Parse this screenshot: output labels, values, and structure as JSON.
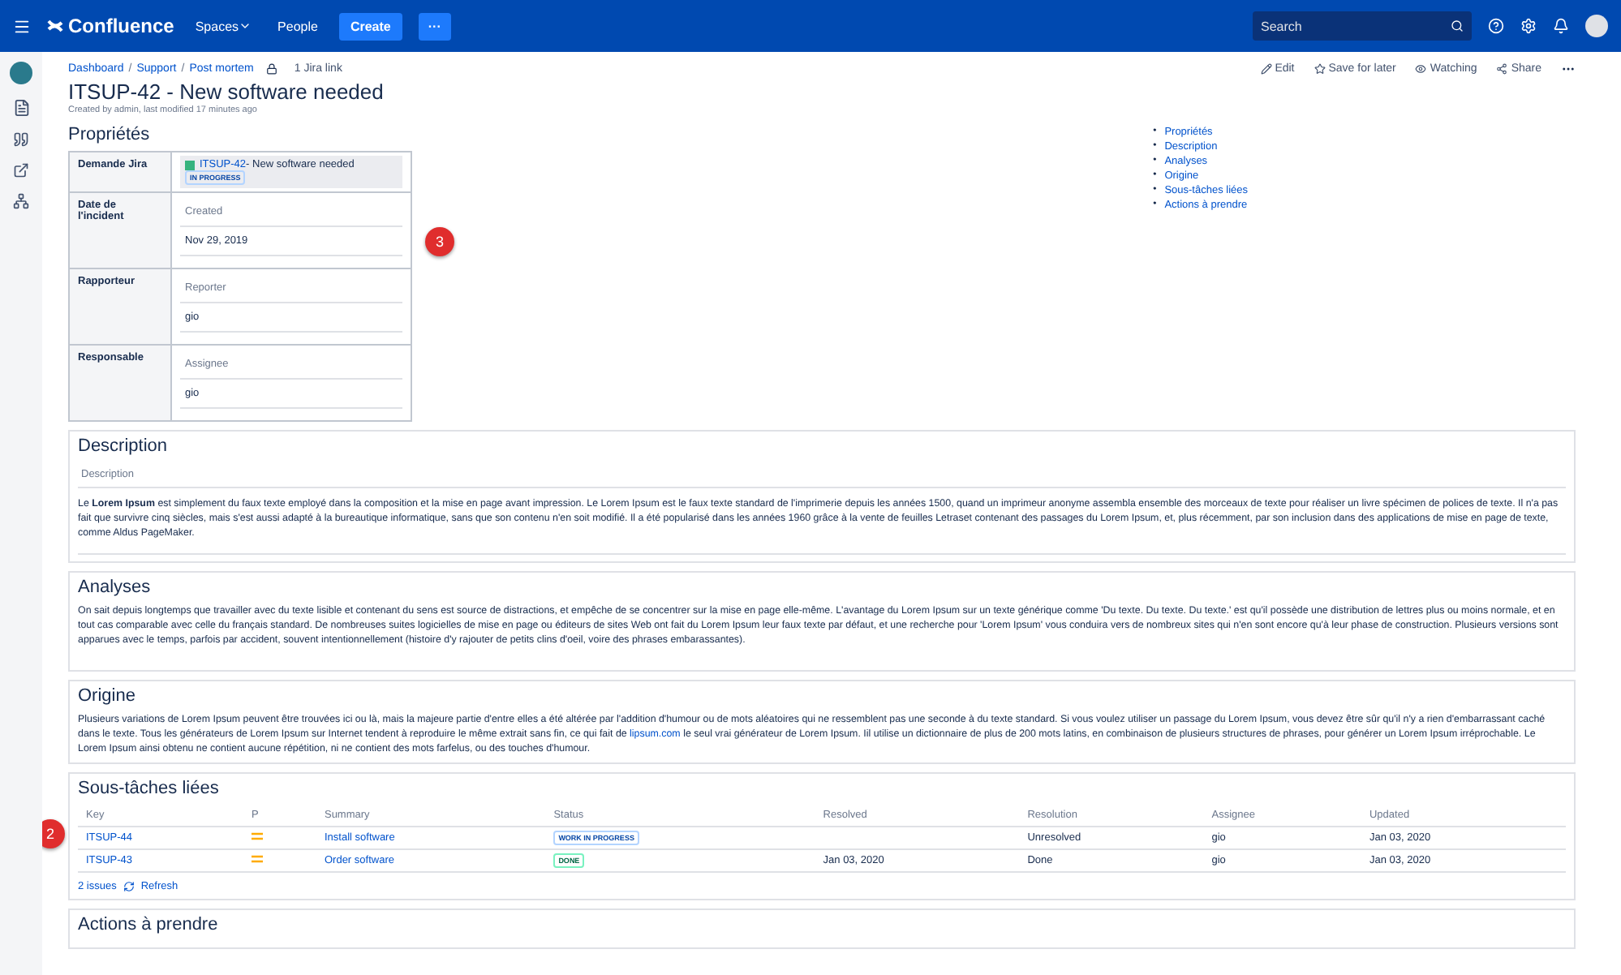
{
  "topbar": {
    "brand": "Confluence",
    "nav": [
      {
        "label": "Spaces",
        "dropdown": true
      },
      {
        "label": "People",
        "dropdown": false
      }
    ],
    "create": "Create",
    "more": "···",
    "search": {
      "placeholder": "Search"
    }
  },
  "breadcrumbs": [
    {
      "kind": "link",
      "text": "Dashboard"
    },
    {
      "kind": "separator",
      "text": "/"
    },
    {
      "kind": "link",
      "text": "Support"
    },
    {
      "kind": "separator",
      "text": "/"
    },
    {
      "kind": "link",
      "text": "Post mortem"
    }
  ],
  "jira_link": "1 Jira link",
  "actions": [
    "Edit",
    "Save for later",
    "Watching",
    "Share"
  ],
  "page": {
    "title": "ITSUP-42 - New software needed",
    "byline": "Created by admin, last modified 17 minutes ago"
  },
  "toc": [
    {
      "bullet": "•",
      "label": "Propriétés"
    },
    {
      "bullet": "•",
      "label": "Description"
    },
    {
      "bullet": "•",
      "label": "Analyses"
    },
    {
      "bullet": "•",
      "label": "Origine"
    },
    {
      "bullet": "•",
      "label": "Sous-tâches liées"
    },
    {
      "bullet": "•",
      "label": "Actions à prendre"
    }
  ],
  "properties": {
    "heading": "Propriétés",
    "jira": {
      "label": "Demande Jira",
      "key": "ITSUP-42",
      "summary": " - New software needed",
      "status": "IN PROGRESS"
    },
    "fields": [
      {
        "label": "Date de l'incident",
        "field": "Created",
        "value": "Nov 29, 2019"
      },
      {
        "label": "Rapporteur",
        "field": "Reporter",
        "value": "gio"
      },
      {
        "label": "Responsable",
        "field": "Assignee",
        "value": "gio"
      }
    ]
  },
  "markers": [
    "3",
    "2"
  ],
  "description": {
    "heading": "Description",
    "field": "Description",
    "text": "Le **Lorem Ipsum** est simplement du faux texte employé dans la composition et la mise en page avant impression. Le Lorem Ipsum est le faux texte standard de l'imprimerie depuis les années 1500, quand un imprimeur anonyme assembla ensemble des morceaux de texte pour réaliser un livre spécimen de polices de texte. Il n'a pas fait que survivre cinq siècles, mais s'est aussi adapté à la bureautique informatique, sans que son contenu n'en soit modifié. Il a été popularisé dans les années 1960 grâce à la vente de feuilles Letraset contenant des passages du Lorem Ipsum, et, plus récemment, par son inclusion dans des applications de mise en page de texte, comme Aldus PageMaker."
  },
  "analyses": {
    "heading": "Analyses",
    "text": "On sait depuis longtemps que travailler avec du texte lisible et contenant du sens est source de distractions, et empêche de se concentrer sur la mise en page elle-même. L'avantage du Lorem Ipsum sur un texte générique comme 'Du texte. Du texte. Du texte.' est qu'il possède une distribution de lettres plus ou moins normale, et en tout cas comparable avec celle du français standard. De nombreuses suites logicielles de mise en page ou éditeurs de sites Web ont fait du Lorem Ipsum leur faux texte par défaut, et une recherche pour 'Lorem Ipsum' vous conduira vers de nombreux sites qui n'en sont encore qu'à leur phase de construction. Plusieurs versions sont apparues avec le temps, parfois par accident, souvent intentionnellement (histoire d'y rajouter de petits clins d'oeil, voire des phrases embarassantes)."
  },
  "origine": {
    "heading": "Origine",
    "text_before": "Plusieurs variations de Lorem Ipsum peuvent être trouvées ici ou là, mais la majeure partie d'entre elles a été altérée par l'addition d'humour ou de mots aléatoires qui ne ressemblent pas une seconde à du texte standard. Si vous voulez utiliser un passage du Lorem Ipsum, vous devez être sûr qu'il n'y a rien d'embarrassant caché dans le texte. Tous les générateurs de Lorem Ipsum sur Internet tendent à reproduire le même extrait sans fin, ce qui fait de ",
    "link": "lipsum.com",
    "text_after": " le seul vrai générateur de Lorem Ipsum. Iil utilise un dictionnaire de plus de 200 mots latins, en combinaison de plusieurs structures de phrases, pour générer un Lorem Ipsum irréprochable. Le Lorem Ipsum ainsi obtenu ne contient aucune répétition, ni ne contient des mots farfelus, ou des touches d'humour."
  },
  "subtasks": {
    "heading": "Sous-tâches liées",
    "columns": [
      "Key",
      "P",
      "Summary",
      "Status",
      "Resolved",
      "Resolution",
      "Assignee",
      "Updated"
    ],
    "rows": [
      {
        "key": "ITSUP-44",
        "summary": "Install software",
        "status": "WORK IN PROGRESS",
        "kind": "progress",
        "resolved": "",
        "resolution": "Unresolved",
        "assignee": "gio",
        "updated": "Jan 03, 2020"
      },
      {
        "key": "ITSUP-43",
        "summary": "Order software",
        "status": "DONE",
        "kind": "done",
        "resolved": "Jan 03, 2020",
        "resolution": "Done",
        "assignee": "gio",
        "updated": "Jan 03, 2020"
      }
    ],
    "count": "2 issues",
    "refresh": "Refresh"
  },
  "next_heading": "Actions à prendre"
}
